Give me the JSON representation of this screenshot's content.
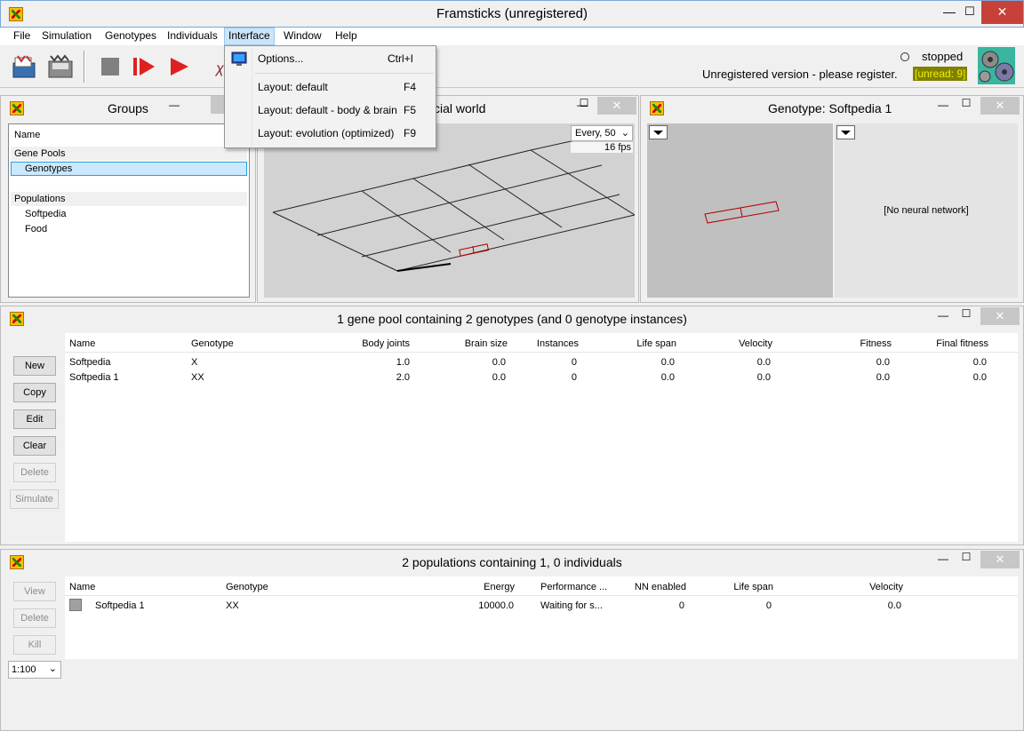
{
  "window": {
    "title": "Framsticks (unregistered)",
    "minimize": "—",
    "maximize": "☐",
    "close": "✕"
  },
  "menu": [
    "File",
    "Simulation",
    "Genotypes",
    "Individuals",
    "Interface",
    "Window",
    "Help"
  ],
  "status": {
    "state": "stopped",
    "register_msg": "Unregistered version - please register.",
    "unread": "[unread: 9]"
  },
  "interface_menu": {
    "items": [
      {
        "label": "Options...",
        "shortcut": "Ctrl+I"
      },
      {
        "label": "Layout: default",
        "shortcut": "F4"
      },
      {
        "label": "Layout: default - body & brain",
        "shortcut": "F5"
      },
      {
        "label": "Layout: evolution (optimized)",
        "shortcut": "F9"
      }
    ]
  },
  "groups_panel": {
    "title": "Groups",
    "header": "Name",
    "gene_pools_label": "Gene Pools",
    "gene_pools": [
      "Genotypes"
    ],
    "populations_label": "Populations",
    "populations": [
      "Softpedia",
      "Food"
    ]
  },
  "world_panel": {
    "title": "cial world",
    "every": "Every, 50",
    "fps": "16 fps"
  },
  "genotype_panel": {
    "title": "Genotype: Softpedia 1",
    "neural": "[No neural network]"
  },
  "genepool_panel": {
    "title": "1 gene pool containing 2 genotypes (and 0 genotype instances)",
    "buttons": {
      "new": "New",
      "copy": "Copy",
      "edit": "Edit",
      "clear": "Clear",
      "delete": "Delete",
      "simulate": "Simulate"
    },
    "columns": [
      "Name",
      "Genotype",
      "Body joints",
      "Brain size",
      "Instances",
      "Life span",
      "Velocity",
      "Fitness",
      "Final fitness"
    ],
    "rows": [
      [
        "Softpedia",
        "X",
        "1.0",
        "0.0",
        "0",
        "0.0",
        "0.0",
        "0.0",
        "0.0"
      ],
      [
        "Softpedia 1",
        "XX",
        "2.0",
        "0.0",
        "0",
        "0.0",
        "0.0",
        "0.0",
        "0.0"
      ]
    ]
  },
  "population_panel": {
    "title": "2 populations containing 1, 0 individuals",
    "buttons": {
      "view": "View",
      "delete": "Delete",
      "kill": "Kill"
    },
    "zoom": "1:100",
    "columns": [
      "Name",
      "Genotype",
      "Energy",
      "Performance ...",
      "NN enabled",
      "Life span",
      "Velocity"
    ],
    "rows": [
      [
        "Softpedia 1",
        "XX",
        "10000.0",
        "Waiting for s...",
        "0",
        "0",
        "0.0"
      ]
    ]
  }
}
